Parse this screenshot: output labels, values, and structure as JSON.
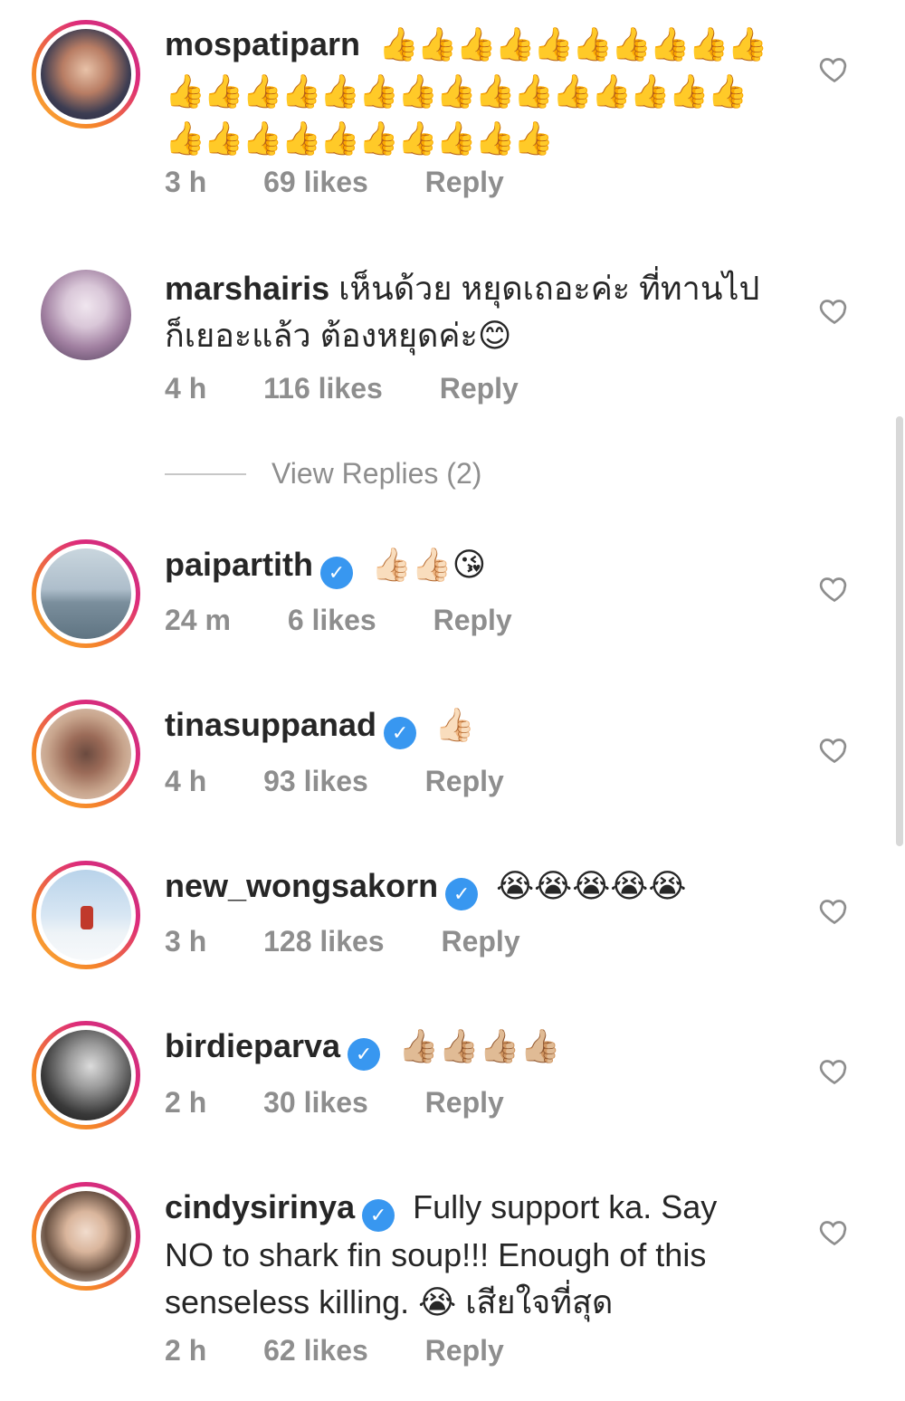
{
  "comments": [
    {
      "username": "mospatiparn",
      "verified": false,
      "text": "👍👍👍👍👍👍👍👍👍👍👍👍👍👍👍👍👍👍👍👍👍👍👍👍👍👍👍👍👍👍👍👍👍👍👍",
      "time": "3 h",
      "likes": "69 likes",
      "reply": "Reply"
    },
    {
      "username": "marshairis",
      "verified": false,
      "text": "เห็นด้วย หยุดเถอะค่ะ  ที่ทานไปก็เยอะแล้ว ต้องหยุดค่ะ😊",
      "time": "4 h",
      "likes": "116 likes",
      "reply": "Reply"
    },
    {
      "username": "paipartith",
      "verified": true,
      "text": "👍🏻👍🏻😘",
      "time": "24 m",
      "likes": "6 likes",
      "reply": "Reply"
    },
    {
      "username": "tinasuppanad",
      "verified": true,
      "text": "👍🏻",
      "time": "4 h",
      "likes": "93 likes",
      "reply": "Reply"
    },
    {
      "username": "new_wongsakorn",
      "verified": true,
      "text": "😭😭😭😭😭",
      "time": "3 h",
      "likes": "128 likes",
      "reply": "Reply"
    },
    {
      "username": "birdieparva",
      "verified": true,
      "text": "👍🏼👍🏼👍🏼👍🏼",
      "time": "2 h",
      "likes": "30 likes",
      "reply": "Reply"
    },
    {
      "username": "cindysirinya",
      "verified": true,
      "text": "Fully support ka. Say NO to shark fin soup!!! Enough of this senseless killing. 😭 เสียใจที่สุด",
      "time": "2 h",
      "likes": "62 likes",
      "reply": "Reply"
    }
  ],
  "view_replies": "View Replies (2)",
  "icons": {
    "like": "heart-outline-icon",
    "verified": "verified-badge-icon"
  },
  "colors": {
    "text": "#262626",
    "meta": "#8e8e8e",
    "verified": "#3897f0",
    "heart": "#8e8e8e"
  }
}
